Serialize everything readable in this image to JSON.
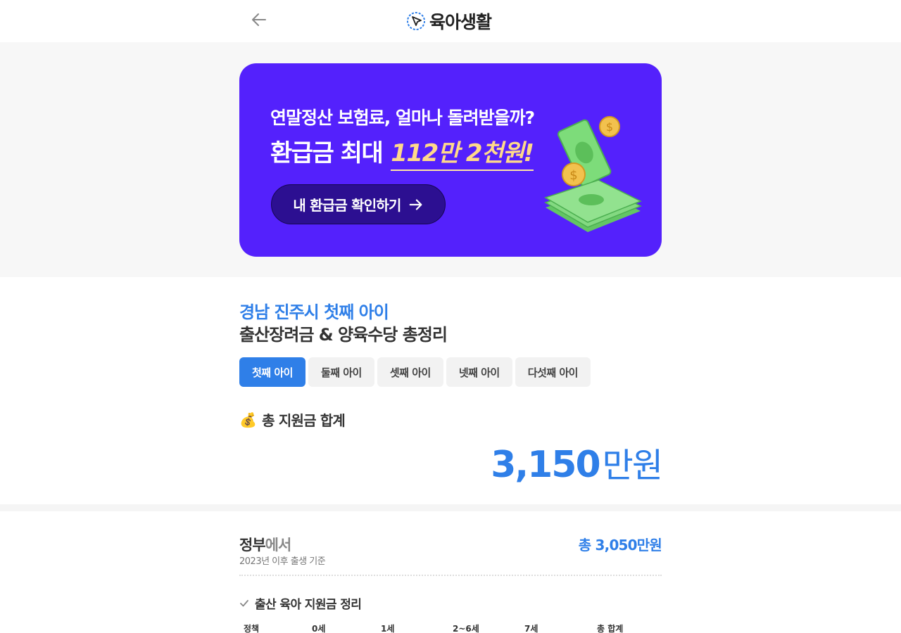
{
  "header": {
    "logo_text": "육아생활"
  },
  "banner": {
    "line1": "연말정산 보험료, 얼마나 돌려받을까?",
    "line2_prefix": "환급금 최대",
    "line2_amount": "112만 2천원!",
    "cta_label": "내 환급금 확인하기",
    "bg_color": "#5421fc",
    "accent_color": "#ffd98a"
  },
  "summary": {
    "subtitle": "경남 진주시 첫째 아이",
    "title": "출산장려금 & 양육수당 총정리",
    "tabs": [
      {
        "label": "첫째 아이",
        "active": true
      },
      {
        "label": "둘째 아이",
        "active": false
      },
      {
        "label": "셋째 아이",
        "active": false
      },
      {
        "label": "넷째 아이",
        "active": false
      },
      {
        "label": "다섯째 아이",
        "active": false
      }
    ],
    "total_label": "총 지원금 합계",
    "total_icon": "💰",
    "total_value": "3,150",
    "total_unit": "만원",
    "accent_color": "#2f7fe8"
  },
  "government": {
    "title_main": "정부",
    "title_suffix": "에서",
    "note": "2023년 이후 출생 기준",
    "total": "총 3,050만원",
    "section_title": "출산 육아 지원금 정리",
    "columns": [
      "정책",
      "0세",
      "1세",
      "2~6세",
      "7세",
      "총 합계"
    ]
  }
}
